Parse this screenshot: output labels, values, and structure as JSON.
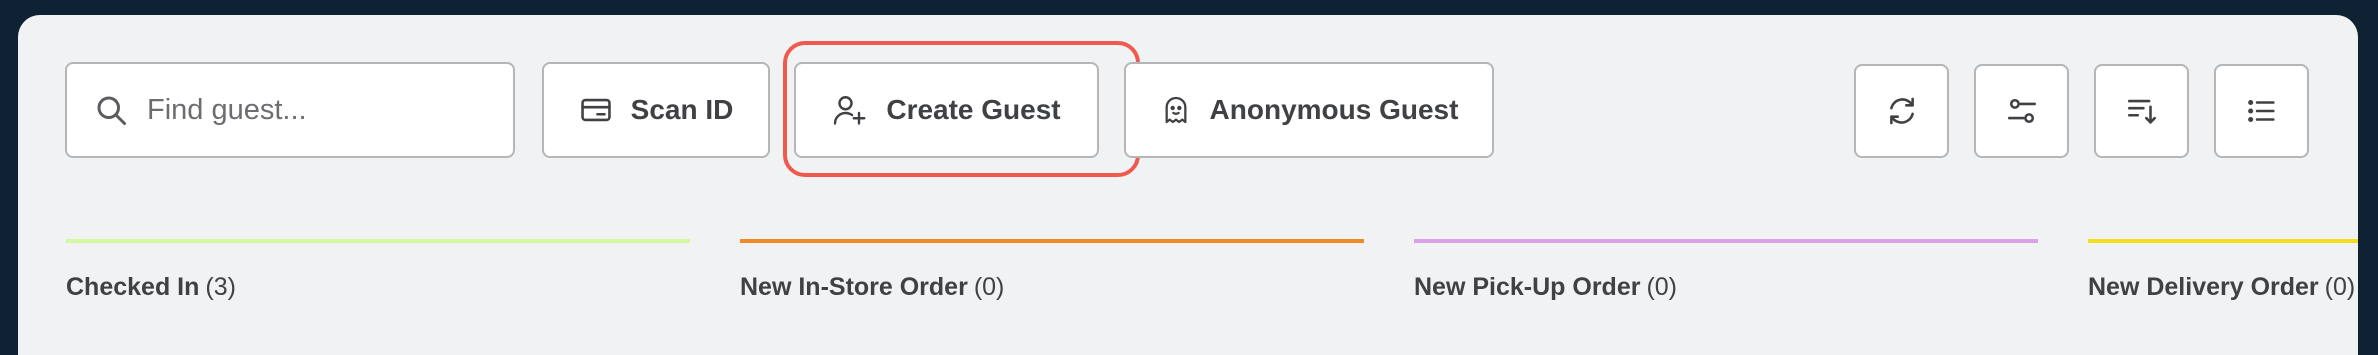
{
  "search": {
    "placeholder": "Find guest...",
    "icon": "search-icon"
  },
  "toolbar": {
    "scan_id_label": "Scan ID",
    "create_guest_label": "Create Guest",
    "anonymous_guest_label": "Anonymous Guest",
    "icons": [
      "refresh-icon",
      "sliders-icon",
      "sort-icon",
      "list-icon"
    ]
  },
  "columns": [
    {
      "title": "Checked In",
      "count": "(3)",
      "color": "#d4f7a0"
    },
    {
      "title": "New In-Store Order",
      "count": "(0)",
      "color": "#f08a24"
    },
    {
      "title": "New Pick-Up Order",
      "count": "(0)",
      "color": "#d9a2e8"
    },
    {
      "title": "New Delivery Order",
      "count": "(0)",
      "color": "#f2e01c"
    }
  ],
  "colors": {
    "highlight": "#ef5a4f",
    "background": "#0f2233",
    "panel": "#f1f2f4"
  }
}
